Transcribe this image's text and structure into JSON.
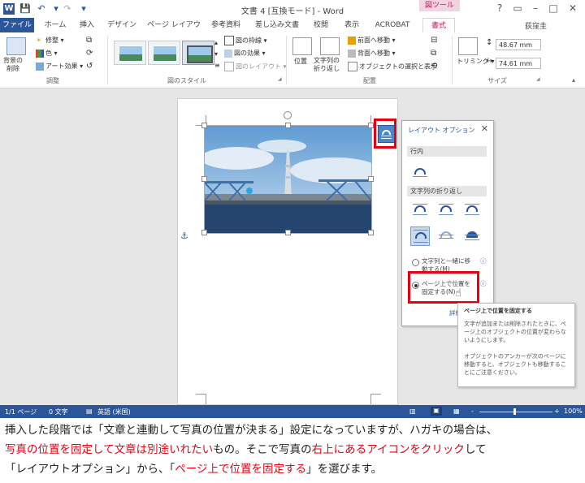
{
  "titlebar": {
    "word_icon": "W",
    "doc_title": "文書 4 [互換モード] - Word",
    "picture_tools": "図ツール",
    "help": "?",
    "restore": "▭",
    "minimize": "–",
    "maximize": "□",
    "close": "✕"
  },
  "tabs": [
    "ファイル",
    "ホーム",
    "挿入",
    "デザイン",
    "ページ レイアウト",
    "参考資料",
    "差し込み文書",
    "校閲",
    "表示",
    "ACROBAT",
    "書式"
  ],
  "user": "荻窪圭",
  "ribbon": {
    "remove_bg": "背景の\n削除",
    "correct": "修整",
    "color": "色",
    "art_effect": "アート効果",
    "group_adjust": "調整",
    "border": "図の枠線",
    "effect": "図の効果",
    "layout": "図のレイアウト",
    "group_styles": "図のスタイル",
    "position": "位置",
    "wrap": "文字列の\n折り返し",
    "bring_forward": "前面へ移動",
    "send_backward": "背面へ移動",
    "selection_pane": "オブジェクトの選択と表示",
    "group_arrange": "配置",
    "crop": "トリミング",
    "height": "48.67 mm",
    "width": "74.61 mm",
    "group_size": "サイズ"
  },
  "panel": {
    "title": "レイアウト オプション",
    "close": "✕",
    "inline_header": "行内",
    "wrap_header": "文字列の折り返し",
    "radio1": "文字列と一緒に移\n動する(M)",
    "radio2": "ページ上で位置を\n固定する(N)",
    "info": "ⓘ",
    "more": "詳細"
  },
  "tooltip": {
    "title": "ページ上で位置を固定する",
    "para1": "文字が追加または削除されたときに、ページ上のオブジェクトの位置が変わらないようにします。",
    "para2": "オブジェクトのアンカーが次のページに移動すると、オブジェクトも移動することにご注意ください。"
  },
  "status": {
    "page": "1/1 ページ",
    "words": "0 文字",
    "lang": "英語 (米国)",
    "zoom_minus": "-",
    "zoom_plus": "+",
    "zoom": "100%"
  },
  "anchor": "⚓",
  "caption": {
    "p1": "挿入した段階では「文章と連動して写真の位置が決まる」設定になっていますが、ハガキの場合は、",
    "p2_red": "写真の位置を固定して文章は別途いれたい",
    "p2b": "もの。そこで写真の",
    "p2_red2": "右上にあるアイコンをクリック",
    "p2c": "して",
    "p3a": "「レイアウトオプション」から、「",
    "p3_red": "ページ上で位置を固定する",
    "p3b": "」を選びます。"
  }
}
